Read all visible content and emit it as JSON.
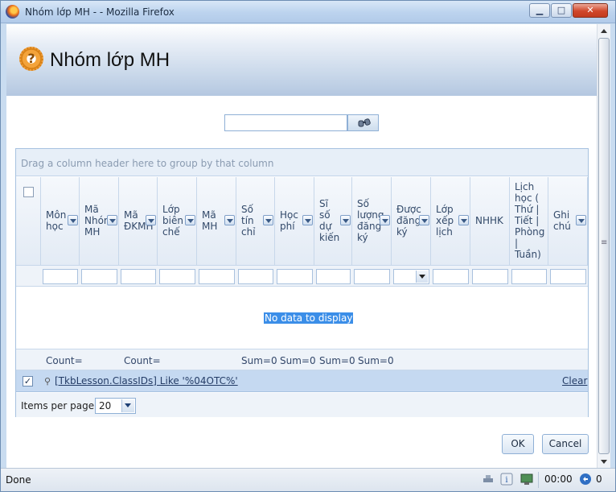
{
  "window": {
    "title": "Nhóm lớp MH - - Mozilla Firefox",
    "controls": {
      "minimize": "▁",
      "maximize": "□",
      "close": "✕"
    }
  },
  "header": {
    "title": "Nhóm lớp MH",
    "logo_glyph": "?"
  },
  "search": {
    "value": ""
  },
  "grid": {
    "group_panel_text": "Drag a column header here to group by that column",
    "columns": [
      {
        "label": [
          "Môn",
          "học"
        ]
      },
      {
        "label": [
          "Mã",
          "Nhóm",
          "MH"
        ]
      },
      {
        "label": [
          "Mã",
          "ĐKMH"
        ]
      },
      {
        "label": [
          "Lớp",
          "biên",
          "chế"
        ]
      },
      {
        "label": [
          "Mã",
          "MH"
        ]
      },
      {
        "label": [
          "Số",
          "tín",
          "chỉ"
        ]
      },
      {
        "label": [
          "Học",
          "phí"
        ]
      },
      {
        "label": [
          "Sĩ",
          "số",
          "dự",
          "kiến"
        ]
      },
      {
        "label": [
          "Số",
          "lượng",
          "đăng",
          "ký"
        ]
      },
      {
        "label": [
          "Được",
          "đăng",
          "ký"
        ]
      },
      {
        "label": [
          "Lớp",
          "xếp",
          "lịch"
        ]
      },
      {
        "label": [
          "NHHK"
        ]
      },
      {
        "label": [
          "Lịch",
          "học (",
          "Thứ |",
          "Tiết |",
          "Phòng",
          "|",
          "Tuần)"
        ]
      },
      {
        "label": [
          "Ghi",
          "chú"
        ]
      }
    ],
    "no_data_text": "No data to display",
    "footer": {
      "count1": "Count=",
      "count2": "Count=",
      "sum1": "Sum=0",
      "sum2": "Sum=0",
      "sum3": "Sum=0",
      "sum4": "Sum=0"
    },
    "filter_expression": "[TkbLesson.ClassIDs] Like '%04OTC%'",
    "filter_checked": true,
    "filter_clear": "Clear",
    "pager": {
      "label": "Items per page:",
      "value": "20"
    }
  },
  "buttons": {
    "ok": "OK",
    "cancel": "Cancel"
  },
  "statusbar": {
    "status": "Done",
    "time": "00:00",
    "count": "0"
  }
}
